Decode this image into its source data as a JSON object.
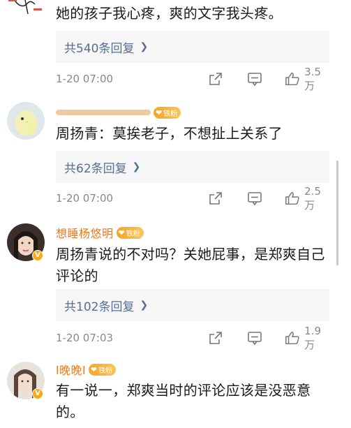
{
  "comments": [
    {
      "username": "",
      "text": "她的孩子我心疼，爽的文字我头疼。",
      "reply_label": "共540条回复",
      "time": "1-20 07:00",
      "likes": "3.5万"
    },
    {
      "username": "",
      "badge": "铁粉",
      "text": "周扬青：莫挨老子，不想扯上关系了",
      "reply_label": "共62条回复",
      "time": "1-20 07:00",
      "likes": "2.5万"
    },
    {
      "username": "想睡杨悠明",
      "badge": "铁粉",
      "text": "周扬青说的不对吗？关她屁事，是郑爽自己评论的",
      "reply_label": "共102条回复",
      "time": "1-20 07:03",
      "likes": "1.9万"
    },
    {
      "username": "l晚晚l",
      "badge": "铁粉",
      "text": "有一说一，郑爽当时的评论应该是没恶意的。"
    }
  ],
  "colors": {
    "username": "#e97a1d",
    "reply_link": "#586e8f",
    "meta": "#888888"
  }
}
